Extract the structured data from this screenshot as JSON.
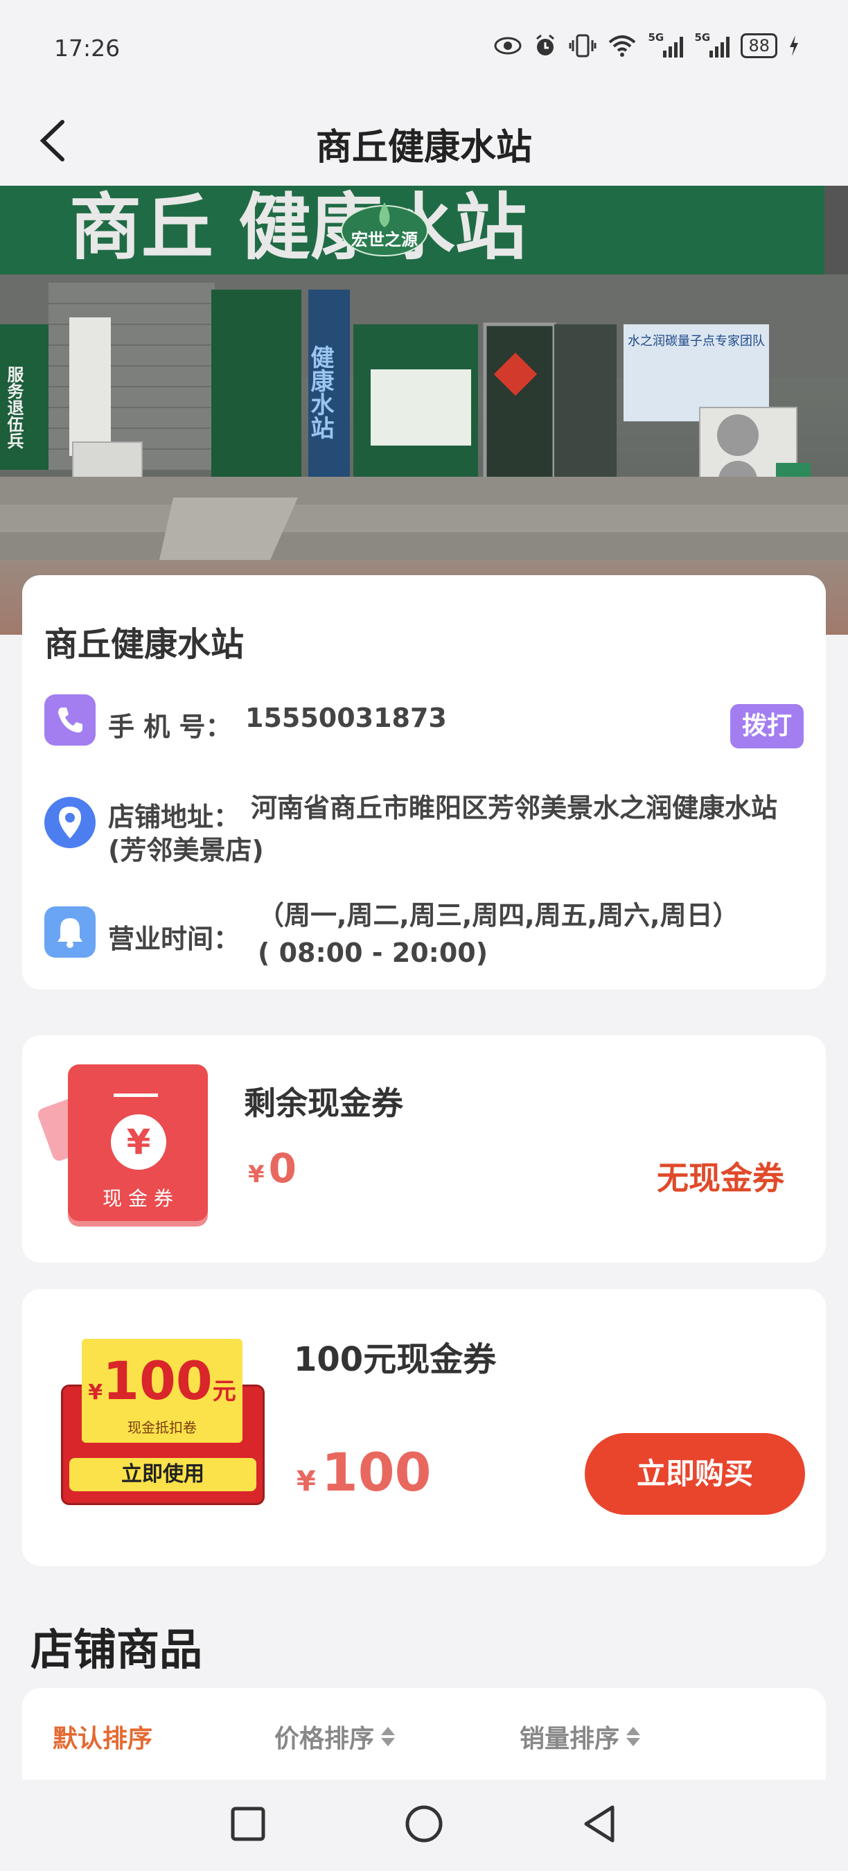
{
  "status_bar": {
    "time": "17:26",
    "signal1_label": "5G",
    "signal2_label": "5G",
    "battery": "88"
  },
  "nav": {
    "title": "商丘健康水站",
    "back_icon": "chevron-left-icon"
  },
  "hero": {
    "sign_text": "商丘  健康水站",
    "brand_text": "宏世之源",
    "door_text": "健康水站",
    "banner_right": "水之润碳量子点专家团队",
    "left_sign": "服务退伍兵"
  },
  "store": {
    "name": "商丘健康水站",
    "phone_label": "手 机 号：",
    "phone_value": "15550031873",
    "dial_label": "拨打",
    "address_label": "店铺地址：",
    "address_value_1": "河南省商丘市睢阳区芳邻美景水之润健康水站",
    "address_value_2": "(芳邻美景店)",
    "hours_label": "营业时间：",
    "hours_days": "（周一,周二,周三,周四,周五,周六,周日）",
    "hours_time": "( 08:00 - 20:00)"
  },
  "cash_voucher": {
    "icon_text": "现 金 券",
    "label": "剩余现金券",
    "currency": "¥",
    "amount": "0",
    "status": "无现金券"
  },
  "coupon": {
    "badge_amount": "100",
    "badge_unit": "元",
    "badge_currency": "¥",
    "badge_sub": "现金抵扣卷",
    "badge_use": "立即使用",
    "label": "100元现金券",
    "currency": "¥",
    "price": "100",
    "buy_label": "立即购买"
  },
  "products": {
    "section_title": "店铺商品",
    "sort_default": "默认排序",
    "sort_price": "价格排序",
    "sort_sales": "销量排序"
  },
  "colors": {
    "accent_red": "#e9452d",
    "price_red": "#e8685f",
    "dial_purple": "#a27ef0",
    "sort_active": "#e46a32"
  }
}
